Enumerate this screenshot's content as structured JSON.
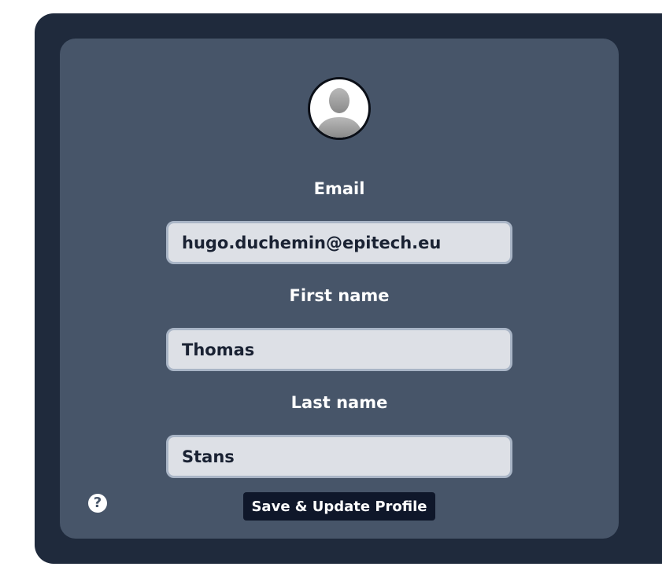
{
  "profile": {
    "avatar_icon": "user-silhouette-icon",
    "email_label": "Email",
    "email_value": "hugo.duchemin@epitech.eu",
    "first_name_label": "First name",
    "first_name_value": "Thomas",
    "last_name_label": "Last name",
    "last_name_value": "Stans",
    "save_label": "Save & Update Profile",
    "help_icon": "question-circle-icon",
    "help_glyph": "?"
  },
  "colors": {
    "outer_background": "#1f2a3c",
    "card_background": "#475569",
    "field_background": "#dde0e6",
    "button_background": "#0f172a"
  }
}
